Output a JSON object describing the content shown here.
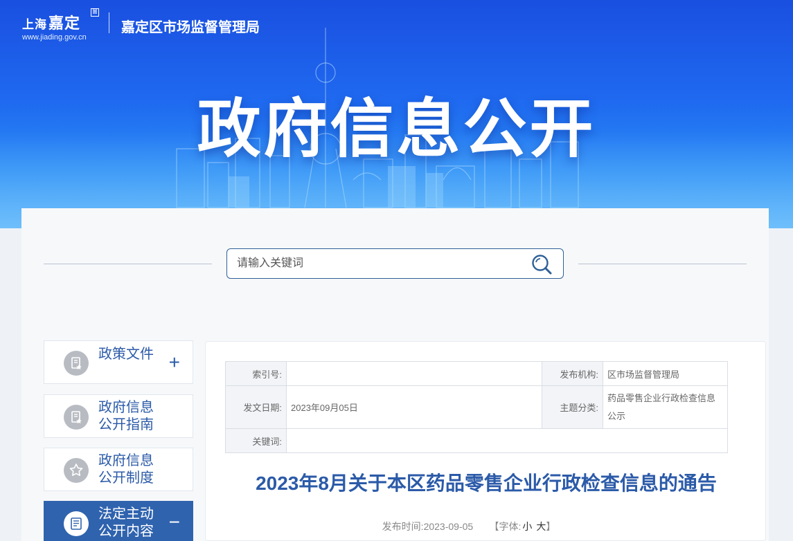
{
  "header": {
    "logo": {
      "prefix": "上海",
      "brand": "嘉定",
      "seal": "圖",
      "url": "www.jiading.gov.cn"
    },
    "agency": "嘉定区市场监督管理局",
    "banner_title": "政府信息公开"
  },
  "search": {
    "placeholder": "请输入关键词",
    "value": ""
  },
  "sidebar": {
    "items": [
      {
        "line1": "政策文件",
        "line2": "",
        "toggle": "+",
        "icon": "document-star-icon"
      },
      {
        "line1": "政府信息",
        "line2": "公开指南",
        "toggle": "",
        "icon": "document-star-icon"
      },
      {
        "line1": "政府信息",
        "line2": "公开制度",
        "toggle": "",
        "icon": "star-icon"
      },
      {
        "line1": "法定主动",
        "line2": "公开内容",
        "toggle": "−",
        "icon": "list-document-icon"
      }
    ]
  },
  "meta": {
    "index_no_label": "索引号:",
    "index_no_value": "",
    "publisher_label": "发布机构:",
    "publisher_value": "区市场监督管理局",
    "date_label": "发文日期:",
    "date_value": "2023年09月05日",
    "topic_label": "主题分类:",
    "topic_value": "药品零售企业行政检查信息公示",
    "keywords_label": "关键词:",
    "keywords_value": ""
  },
  "document": {
    "title": "2023年8月关于本区药品零售企业行政检查信息的通告",
    "publish_label": "发布时间:",
    "publish_date": "2023-09-05",
    "font_label": "【字体:",
    "font_small": "小",
    "font_large": "大",
    "font_close": "】"
  },
  "colors": {
    "accent": "#2b5aa8",
    "active_bg": "#2f63ae",
    "banner": "#1f6af0"
  }
}
